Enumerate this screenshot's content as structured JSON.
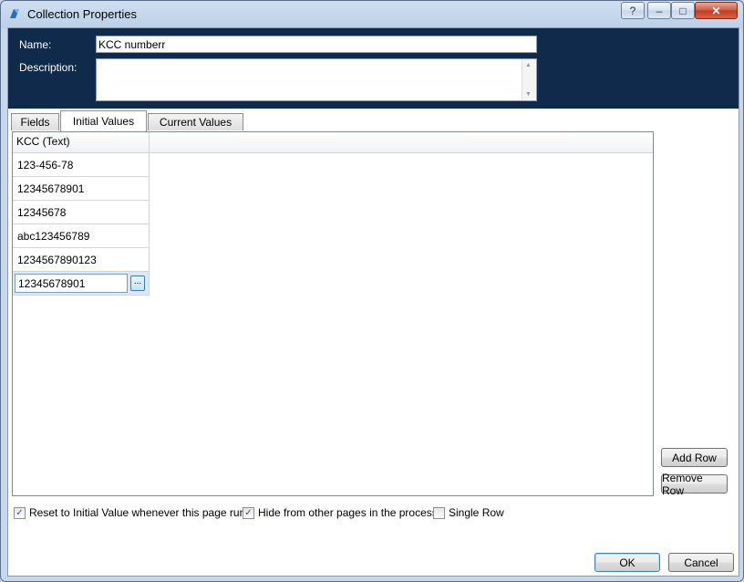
{
  "window": {
    "title": "Collection Properties",
    "buttons": {
      "help": "?",
      "minimize": "–",
      "maximize": "□",
      "close": "✕"
    }
  },
  "header": {
    "name_label": "Name:",
    "name_value": "KCC numberr",
    "description_label": "Description:",
    "description_value": ""
  },
  "tabs": [
    {
      "label": "Fields",
      "active": false
    },
    {
      "label": "Initial Values",
      "active": true
    },
    {
      "label": "Current Values",
      "active": false
    }
  ],
  "grid": {
    "column_header": "KCC   (Text)",
    "rows": [
      "123-456-78",
      "12345678901",
      "12345678",
      "abc123456789",
      "1234567890123"
    ],
    "editing_row_value": "12345678901",
    "ellipsis_label": "..."
  },
  "side_buttons": {
    "add_row": "Add Row",
    "remove_row": "Remove Row"
  },
  "options": [
    {
      "label": "Reset to Initial Value whenever this page runs",
      "checked": true
    },
    {
      "label": "Hide from other pages in the process",
      "checked": true
    },
    {
      "label": "Single Row",
      "checked": false
    }
  ],
  "footer": {
    "ok": "OK",
    "cancel": "Cancel"
  },
  "colors": {
    "header_bg": "#0f2a4a",
    "close_button": "#c23b20"
  }
}
